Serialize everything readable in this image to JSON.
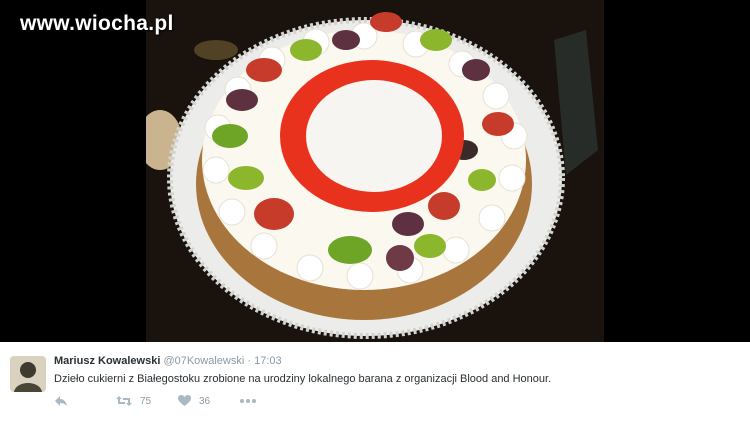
{
  "watermark": {
    "text": "www.wiocha.pl"
  },
  "photo": {
    "subject": "decorated cream cake with fruit, centre emblem not reproduced",
    "colors": {
      "cream": "#fbf8f0",
      "emblem_red": "#e8321d",
      "crust": "#a8763c"
    }
  },
  "tweet": {
    "author_name": "Mariusz Kowalewski",
    "author_handle": "@07Kowalewski",
    "separator": "·",
    "time": "17:03",
    "text": "Dzieło cukierni z Białegostoku zrobione na urodziny lokalnego barana z organizacji Blood and Honour.",
    "actions": {
      "reply": {
        "icon": "reply-icon"
      },
      "retweet": {
        "icon": "retweet-icon",
        "count": "75"
      },
      "like": {
        "icon": "heart-icon",
        "count": "36"
      },
      "more": {
        "icon": "more-icon"
      }
    }
  },
  "colors": {
    "name": "#292f33",
    "muted": "#8899a6",
    "icon": "#aab8c2"
  }
}
